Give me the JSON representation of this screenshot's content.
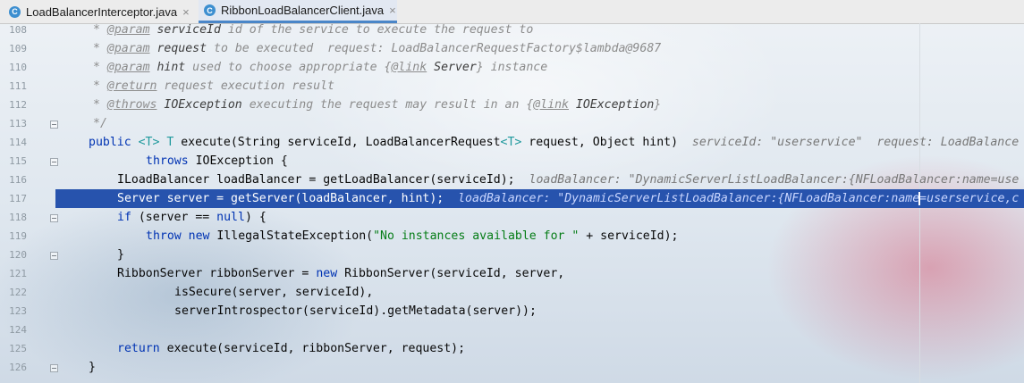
{
  "tabs": [
    {
      "icon": "C",
      "label": "LoadBalancerInterceptor.java",
      "close": "×"
    },
    {
      "icon": "C",
      "label": "RibbonLoadBalancerClient.java",
      "close": "×"
    }
  ],
  "line_numbers": [
    "108",
    "109",
    "110",
    "111",
    "112",
    "113",
    "114",
    "115",
    "116",
    "117",
    "118",
    "119",
    "120",
    "121",
    "122",
    "123",
    "124",
    "125",
    "126"
  ],
  "code": {
    "l108": {
      "a": "* ",
      "b": "@param",
      "c": " serviceId",
      "d": " id of the service to execute the request to"
    },
    "l109": {
      "a": "* ",
      "b": "@param",
      "c": " request",
      "d": " to be executed  request: LoadBalancerRequestFactory$lambda@9687"
    },
    "l110": {
      "a": "* ",
      "b": "@param",
      "c": " hint",
      "d": " used to choose appropriate {",
      "e": "@link",
      "f": " Server",
      "g": "} instance"
    },
    "l111": {
      "a": "* ",
      "b": "@return",
      "d": " request execution result"
    },
    "l112": {
      "a": "* ",
      "b": "@throws",
      "c": " IOException",
      "d": " executing the request may result in an {",
      "e": "@link",
      "f": " IOException",
      "g": "}"
    },
    "l113": {
      "a": "*/"
    },
    "l114": {
      "kw": "public",
      "g1": " <T>",
      "g2": " T",
      "rest": " execute(String serviceId, LoadBalancerRequest",
      "g3": "<T>",
      "rest2": " request, Object hint)",
      "hint": "  serviceId: \"userservice\"  request: LoadBalance"
    },
    "l115": {
      "kw": "throws",
      "rest": " IOException {"
    },
    "l116": {
      "rest": "ILoadBalancer loadBalancer = getLoadBalancer(serviceId);",
      "hint": "  loadBalancer: \"DynamicServerListLoadBalancer:{NFLoadBalancer:name=use"
    },
    "l117": {
      "rest": "Server server = getServer(loadBalancer, hint);",
      "hint": "  loadBalancer: \"DynamicServerListLoadBalancer:{NFLoadBalancer:name=userservice,c"
    },
    "l118": {
      "kw": "if",
      "rest": " (server == ",
      "kw2": "null",
      "rest2": ") {"
    },
    "l119": {
      "kw": "throw new",
      "rest": " IllegalStateException(",
      "str": "\"No instances available for \"",
      "rest2": " + serviceId);"
    },
    "l120": {
      "rest": "}"
    },
    "l121": {
      "rest": "RibbonServer ribbonServer = ",
      "kw": "new",
      "rest2": " RibbonServer(serviceId, server,"
    },
    "l122": {
      "rest": "isSecure(server, serviceId),"
    },
    "l123": {
      "rest": "serverIntrospector(serviceId).getMetadata(server));"
    },
    "l124": {
      "rest": ""
    },
    "l125": {
      "kw": "return",
      "rest": " execute(serviceId, ribbonServer, request);"
    },
    "l126": {
      "rest": "}"
    }
  },
  "colors": {
    "highlight_line": "#2753ad",
    "keyword": "#0033b3",
    "string": "#067d17",
    "generic": "#20999d",
    "comment": "#8c8c8c"
  }
}
